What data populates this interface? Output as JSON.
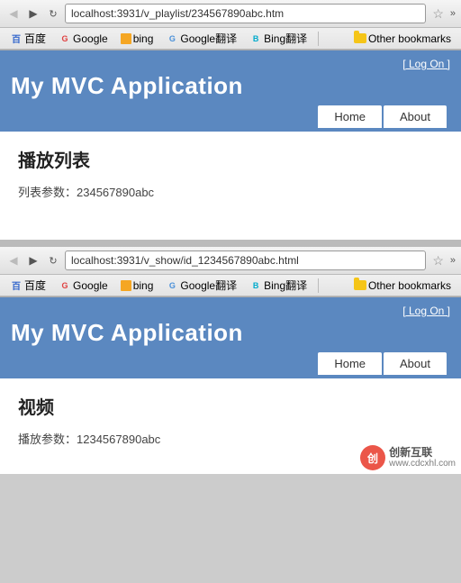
{
  "browser1": {
    "url": "localhost:3931/v_playlist/234567890abc.htm",
    "bookmarks": [
      "百度",
      "Google",
      "bing",
      "Google翻译",
      "Bing翻译"
    ],
    "other_bookmarks": "Other bookmarks",
    "log_on": "[ Log On ]",
    "app_title": "My MVC Application",
    "nav": {
      "home": "Home",
      "about": "About"
    },
    "content": {
      "heading": "播放列表",
      "param_label": "列表参数：",
      "param_value": "234567890abc"
    }
  },
  "browser2": {
    "url": "localhost:3931/v_show/id_1234567890abc.html",
    "bookmarks": [
      "百度",
      "Google",
      "bing",
      "Google翻译",
      "Bing翻译"
    ],
    "other_bookmarks": "Other bookmarks",
    "log_on": "[ Log On ]",
    "app_title": "My MVC Application",
    "nav": {
      "home": "Home",
      "about": "About"
    },
    "content": {
      "heading": "视频",
      "param_label": "播放参数：",
      "param_value": "1234567890abc"
    }
  },
  "watermark": {
    "text": "创新互联",
    "subtext": "www.cdcxhl.com"
  },
  "icons": {
    "back": "◄",
    "forward": "►",
    "reload": "↻",
    "star": "☆",
    "more": "»"
  }
}
